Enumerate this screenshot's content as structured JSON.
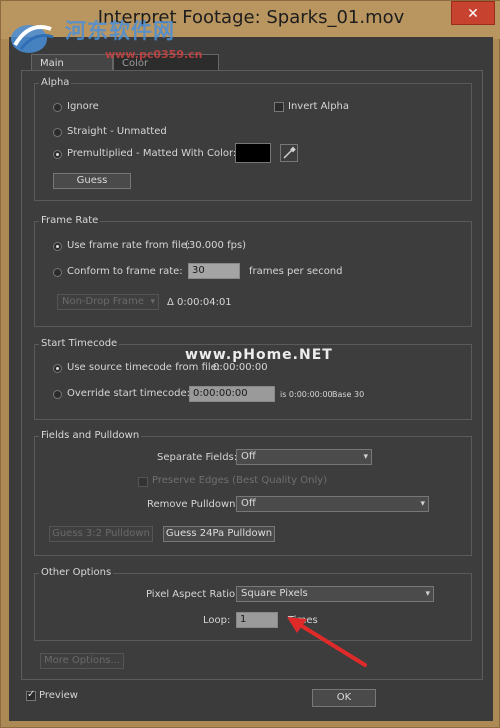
{
  "window": {
    "title": "Interpret Footage: Sparks_01.mov",
    "close_icon": "close-icon"
  },
  "watermark": {
    "site_name": "河东软件网",
    "site_url": "www.pc0359.cn",
    "overlay": "www.pHome.NET"
  },
  "tabs": [
    {
      "label": "Main Options"
    },
    {
      "label": "Color Management"
    }
  ],
  "alpha": {
    "title": "Alpha",
    "ignore": "Ignore",
    "invert": "Invert Alpha",
    "straight": "Straight - Unmatted",
    "premult": "Premultiplied - Matted With Color:",
    "guess": "Guess",
    "selected": "premult",
    "matte_color": "#000000"
  },
  "frame_rate": {
    "title": "Frame Rate",
    "use_file": "Use frame rate from file:",
    "file_fps": "(30.000 fps)",
    "conform": "Conform to frame rate:",
    "conform_value": "30",
    "fps_unit": "frames per second",
    "drop_frame": "Non-Drop Frame",
    "duration": "Δ 0:00:04:01",
    "selected": "use_file"
  },
  "start_timecode": {
    "title": "Start Timecode",
    "use_source": "Use source timecode from file:",
    "source_value": "0:00:00:00",
    "override": "Override start timecode:",
    "override_value": "0:00:00:00",
    "info": "is 0:00:00:00",
    "base": "Base 30",
    "selected": "use_source"
  },
  "fields": {
    "title": "Fields and Pulldown",
    "separate_label": "Separate Fields:",
    "separate_value": "Off",
    "preserve_edges": "Preserve Edges (Best Quality Only)",
    "remove_label": "Remove Pulldown:",
    "remove_value": "Off",
    "guess_32": "Guess 3:2 Pulldown",
    "guess_24pa": "Guess 24Pa Pulldown"
  },
  "other": {
    "title": "Other Options",
    "par_label": "Pixel Aspect Ratio:",
    "par_value": "Square Pixels",
    "loop_label": "Loop:",
    "loop_value": "1",
    "times": "Times"
  },
  "footer": {
    "more_options": "More Options...",
    "preview": "Preview",
    "preview_checked": true,
    "ok": "OK"
  },
  "colors": {
    "annotation_arrow": "#e02a2a"
  }
}
